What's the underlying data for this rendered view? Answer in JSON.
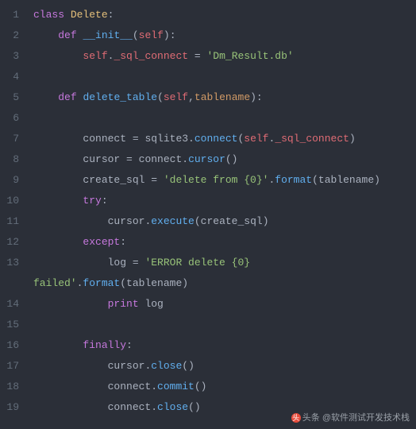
{
  "line_numbers": [
    "1",
    "2",
    "3",
    "4",
    "5",
    "6",
    "7",
    "8",
    "9",
    "10",
    "11",
    "12",
    "13",
    "14",
    "15",
    "16",
    "17",
    "18",
    "19"
  ],
  "code": {
    "l1": {
      "kw1": "class",
      "cls": "Delete",
      "punc": ":"
    },
    "l2": {
      "kw1": "def",
      "fn": "__init__",
      "p1": "(",
      "self": "self",
      "p2": "):"
    },
    "l3": {
      "self": "self",
      "dot": ".",
      "prop": "_sql_connect",
      "eq": " = ",
      "str": "'Dm_Result.db'"
    },
    "l5": {
      "kw1": "def",
      "fn": "delete_table",
      "p1": "(",
      "self": "self",
      "comma": ",",
      "param": "tablename",
      "p2": "):"
    },
    "l7": {
      "var": "connect",
      "eq": " = ",
      "mod": "sqlite3",
      "dot": ".",
      "fn": "connect",
      "p1": "(",
      "self": "self",
      "dot2": ".",
      "prop": "_sql_connect",
      "p2": ")"
    },
    "l8": {
      "var": "cursor",
      "eq": " = ",
      "obj": "connect",
      "dot": ".",
      "fn": "cursor",
      "p": "()"
    },
    "l9": {
      "var": "create_sql",
      "eq": " = ",
      "str": "'delete from {0}'",
      "dot": ".",
      "fn": "format",
      "p1": "(",
      "param": "tablename",
      "p2": ")"
    },
    "l10": {
      "kw": "try",
      "colon": ":"
    },
    "l11": {
      "obj": "cursor",
      "dot": ".",
      "fn": "execute",
      "p1": "(",
      "arg": "create_sql",
      "p2": ")"
    },
    "l12": {
      "kw": "except",
      "colon": ":"
    },
    "l13a": {
      "var": "log",
      "eq": " = ",
      "str": "'ERROR delete {0} "
    },
    "l13b": {
      "str": "failed'",
      "dot": ".",
      "fn": "format",
      "p1": "(",
      "param": "tablename",
      "p2": ")"
    },
    "l14": {
      "kw": "print",
      "sp": " ",
      "var": "log"
    },
    "l16": {
      "kw": "finally",
      "colon": ":"
    },
    "l17": {
      "obj": "cursor",
      "dot": ".",
      "fn": "close",
      "p": "()"
    },
    "l18": {
      "obj": "connect",
      "dot": ".",
      "fn": "commit",
      "p": "()"
    },
    "l19": {
      "obj": "connect",
      "dot": ".",
      "fn": "close",
      "p": "()"
    }
  },
  "watermark": {
    "logo": "头",
    "text": "头条 @软件测试开发技术栈"
  }
}
